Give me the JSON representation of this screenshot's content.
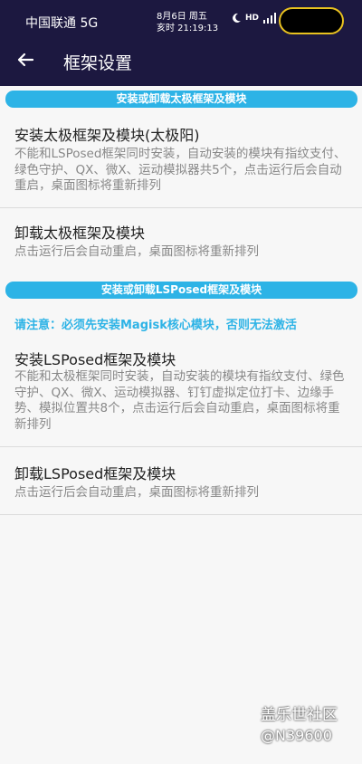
{
  "status": {
    "carrier": "中国联通 5G",
    "date_line": "8月6日 周五",
    "time_line": "亥时 21:19:13",
    "icons": [
      "moon-icon",
      "hd-icon",
      "signal-icon"
    ]
  },
  "header": {
    "title": "框架设置",
    "back_icon": "back-arrow-icon"
  },
  "sections": [
    {
      "banner": "安装或卸载太极框架及模块"
    },
    {
      "banner": "安装或卸载LSPosed框架及模块"
    }
  ],
  "items": [
    {
      "title": "安装太极框架及模块(太极阳)",
      "desc": "不能和LSPosed框架同时安装，自动安装的模块有指纹支付、绿色守护、QX、微X、运动模拟器共5个，点击运行后会自动重启，桌面图标将重新排列"
    },
    {
      "title": "卸载太极框架及模块",
      "desc": "点击运行后会自动重启，桌面图标将重新排列"
    },
    {
      "title": "安装LSPosed框架及模块",
      "desc": "不能和太极框架同时安装，自动安装的模块有指纹支付、绿色守护、QX、微X、运动模拟器、钉钉虚拟定位打卡、边缘手势、模拟位置共8个，点击运行后会自动重启，桌面图标将重新排列"
    },
    {
      "title": "卸载LSPosed框架及模块",
      "desc": "点击运行后会自动重启，桌面图标将重新排列"
    }
  ],
  "warning": "请注意：必须先安装Magisk核心模块，否则无法激活",
  "watermark": {
    "line1": "盖乐世社区",
    "line2": "@N39600"
  },
  "colors": {
    "header_bg": "#1c1840",
    "accent": "#2db3e6",
    "background": "#f7f7f7"
  }
}
